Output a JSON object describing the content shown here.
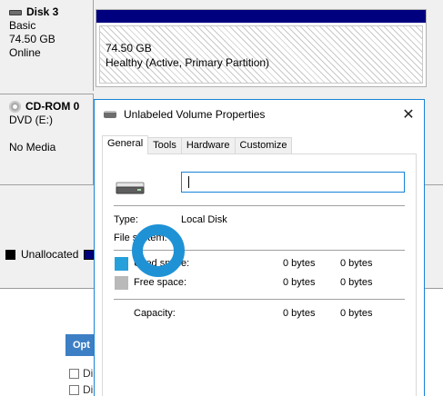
{
  "disk_management": {
    "disk3": {
      "name": "Disk 3",
      "type": "Basic",
      "size": "74.50 GB",
      "status": "Online"
    },
    "partition": {
      "size": "74.50 GB",
      "status": "Healthy (Active, Primary Partition)"
    },
    "cdrom": {
      "name": "CD-ROM 0",
      "type": "DVD (E:)",
      "status": "No Media"
    },
    "legend": [
      {
        "label": "Unallocated",
        "color": "#000000"
      },
      {
        "label": "",
        "color": "#00007f"
      }
    ]
  },
  "options_panel": {
    "button_label": "Opt",
    "checkboxes": [
      "Di",
      "Di"
    ]
  },
  "dialog": {
    "title": "Unlabeled Volume Properties",
    "close_glyph": "✕",
    "tabs": [
      "General",
      "Tools",
      "Hardware",
      "Customize"
    ],
    "active_tab": "General",
    "volume_name_value": "",
    "type_label": "Type:",
    "type_value": "Local Disk",
    "filesystem_label": "File system:",
    "filesystem_value": "",
    "used_label": "Used space:",
    "used_bytes": "0 bytes",
    "used_size": "0 bytes",
    "used_color": "#26a0da",
    "free_label": "Free space:",
    "free_bytes": "0 bytes",
    "free_size": "0 bytes",
    "free_color": "#b9b9b9",
    "capacity_label": "Capacity:",
    "capacity_bytes": "0 bytes",
    "capacity_size": "0 bytes",
    "accent_color": "#1883d7"
  }
}
